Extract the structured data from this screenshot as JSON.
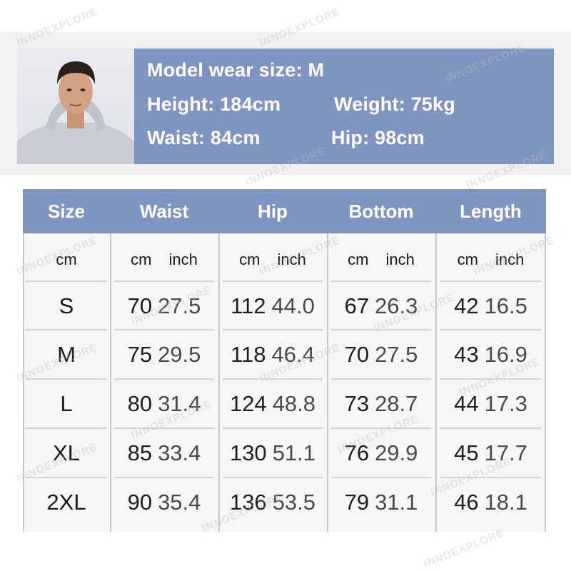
{
  "model": {
    "wear_size": "Model wear size: M",
    "height": "Height: 184cm",
    "weight": "Weight: 75kg",
    "waist": "Waist: 84cm",
    "hip": "Hip: 98cm"
  },
  "table": {
    "headers": [
      "Size",
      "Waist",
      "Hip",
      "Bottom",
      "Length"
    ],
    "size_unit": "cm",
    "unit_cm": "cm",
    "unit_inch": "inch",
    "rows": [
      {
        "size": "S",
        "waist": [
          "70",
          "27.5"
        ],
        "hip": [
          "112",
          "44.0"
        ],
        "bottom": [
          "67",
          "26.3"
        ],
        "length": [
          "42",
          "16.5"
        ]
      },
      {
        "size": "M",
        "waist": [
          "75",
          "29.5"
        ],
        "hip": [
          "118",
          "46.4"
        ],
        "bottom": [
          "70",
          "27.5"
        ],
        "length": [
          "43",
          "16.9"
        ]
      },
      {
        "size": "L",
        "waist": [
          "80",
          "31.4"
        ],
        "hip": [
          "124",
          "48.8"
        ],
        "bottom": [
          "73",
          "28.7"
        ],
        "length": [
          "44",
          "17.3"
        ]
      },
      {
        "size": "XL",
        "waist": [
          "85",
          "33.4"
        ],
        "hip": [
          "130",
          "51.1"
        ],
        "bottom": [
          "76",
          "29.9"
        ],
        "length": [
          "45",
          "17.7"
        ]
      },
      {
        "size": "2XL",
        "waist": [
          "90",
          "35.4"
        ],
        "hip": [
          "136",
          "53.5"
        ],
        "bottom": [
          "79",
          "31.1"
        ],
        "length": [
          "46",
          "18.1"
        ]
      }
    ]
  },
  "watermark": "INNOEXPLORE",
  "colors": {
    "accent": "#7f95c1"
  }
}
